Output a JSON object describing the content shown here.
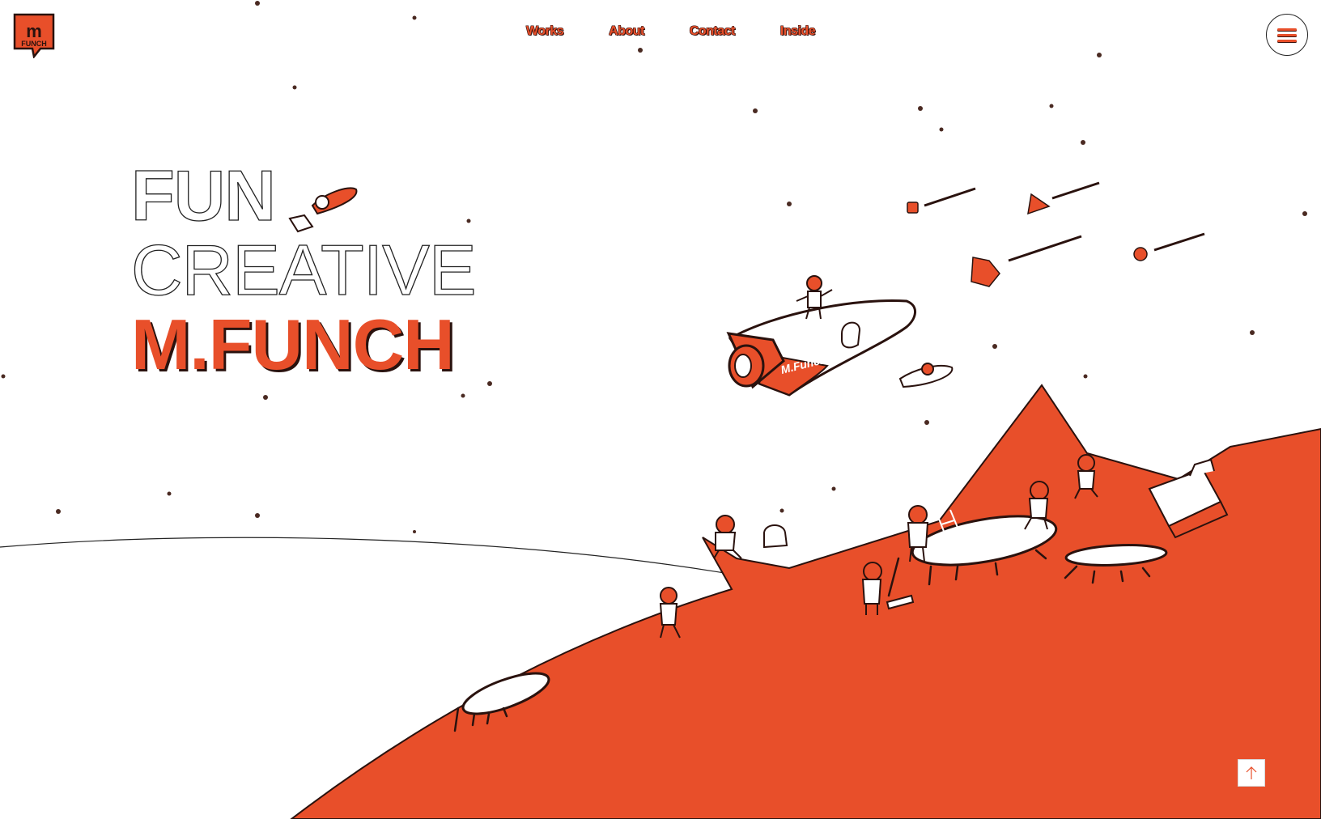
{
  "brand": {
    "logo_text": "FUNCH",
    "accent": "#e84f2a",
    "ink": "#2a120e"
  },
  "nav": {
    "items": [
      {
        "label": "Works"
      },
      {
        "label": "About"
      },
      {
        "label": "Contact"
      },
      {
        "label": "Inside"
      }
    ]
  },
  "menu": {
    "icon": "hamburger-icon"
  },
  "hero": {
    "line1": "FUN",
    "line2": "CREATIVE",
    "line3": "M.FUNCH"
  },
  "illustration": {
    "rocket_label": "M.Funch"
  },
  "back_to_top": {
    "icon": "arrow-up-icon"
  }
}
